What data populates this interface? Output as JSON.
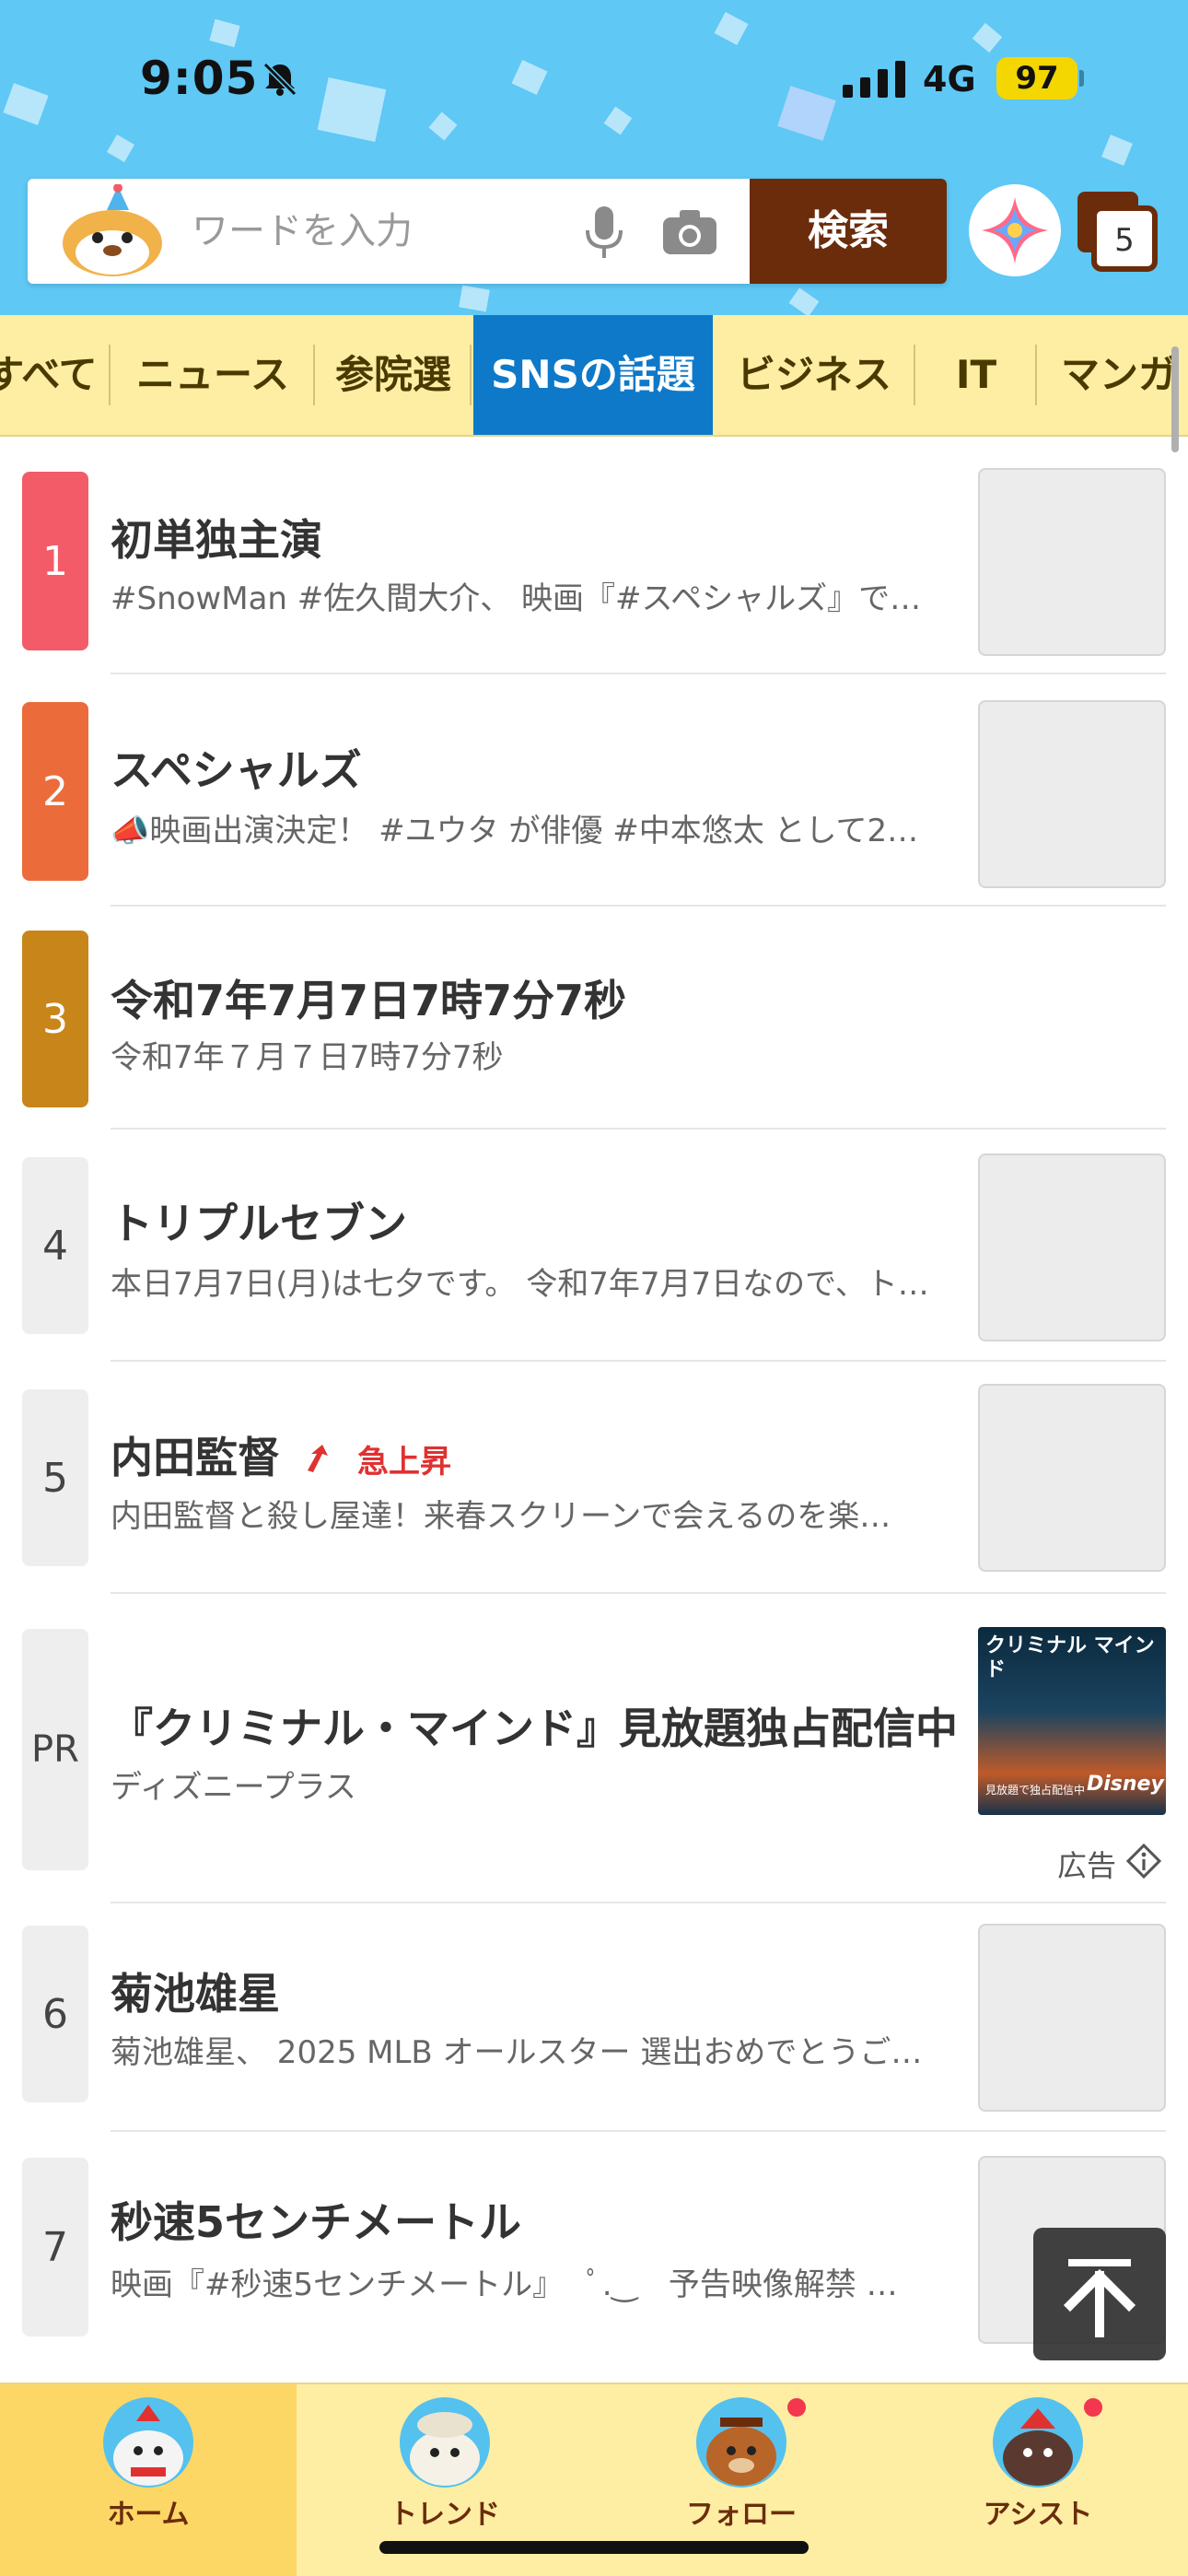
{
  "status_bar": {
    "time": "9:05",
    "network": "4G",
    "battery": "97"
  },
  "search": {
    "placeholder": "ワードを入力",
    "button_label": "検索",
    "tab_count": "5"
  },
  "categories": [
    {
      "label": "すべて"
    },
    {
      "label": "ニュース"
    },
    {
      "label": "参院選"
    },
    {
      "label": "SNSの話題",
      "active": true
    },
    {
      "label": "ビジネス"
    },
    {
      "label": "IT"
    },
    {
      "label": "マンガ"
    }
  ],
  "trends": [
    {
      "rank": "1",
      "title": "初単独主演",
      "desc": "#SnowMan #佐久間大介、 映画『#スペシャルズ』で…",
      "color": "#f45b69"
    },
    {
      "rank": "2",
      "title": "スペシャルズ",
      "desc": "📣映画出演決定！ #ユウタ が俳優 #中本悠太 として2…",
      "color": "#ec6b3a"
    },
    {
      "rank": "3",
      "title": "令和7年7月7日7時7分7秒",
      "desc": "令和7年７月７日7時7分7秒",
      "color": "#c8851a"
    },
    {
      "rank": "4",
      "title": "トリプルセブン",
      "desc": "本日7月7日(月)は七夕です。 令和7年7月7日なので、ト…"
    },
    {
      "rank": "5",
      "title": "内田監督",
      "badge": "急上昇",
      "desc": "内田監督と殺し屋達！来春スクリーンで会えるのを楽…"
    },
    {
      "rank": "6",
      "title": "菊池雄星",
      "desc": "菊池雄星、 2025 MLB オールスター 選出おめでとうご…"
    },
    {
      "rank": "7",
      "title": "秒速5センチメートル",
      "desc": "映画『#秒速5センチメートル』　 ﾟ.‿　予告映像解禁 …"
    }
  ],
  "ad": {
    "rank": "PR",
    "title": "『クリミナル・マインド』見放題独占配信中",
    "sponsor": "ディズニープラス",
    "label": "広告",
    "thumb_title": "クリミナル マインド",
    "thumb_caption": "見放題で独占配信中",
    "thumb_brand": "Disney+"
  },
  "bottom_nav": [
    {
      "label": "ホーム",
      "active": true
    },
    {
      "label": "トレンド"
    },
    {
      "label": "フォロー",
      "badge": true
    },
    {
      "label": "アシスト",
      "badge": true
    }
  ],
  "icons": [
    "bell-slash-icon",
    "signal-icon",
    "mascot-icon",
    "mic-icon",
    "camera-icon",
    "ai-assistant-icon",
    "tabs-icon",
    "trend-up-icon",
    "ad-info-icon",
    "arrow-up-icon"
  ]
}
